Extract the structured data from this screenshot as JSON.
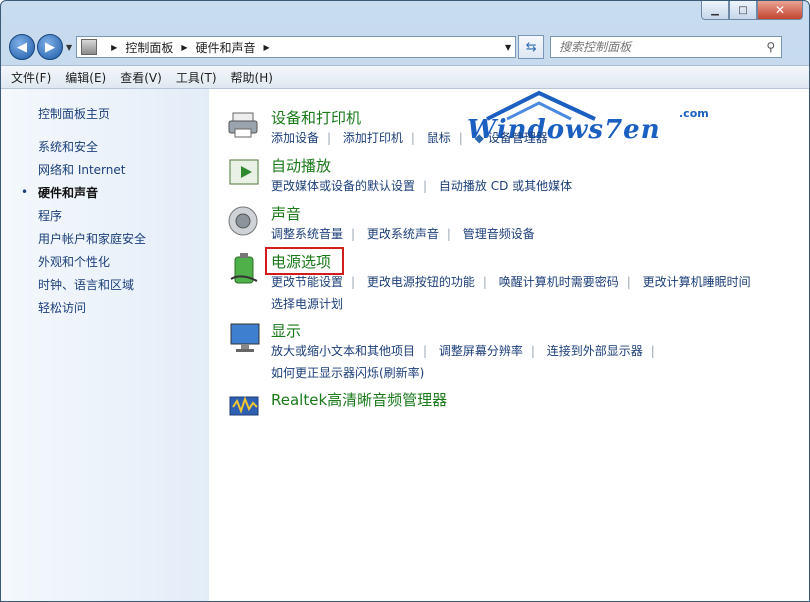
{
  "window": {
    "caption": {
      "minimize": "▁",
      "maximize": "□",
      "close": "✕"
    }
  },
  "address": {
    "crumbs": [
      "控制面板",
      "硬件和声音"
    ]
  },
  "search": {
    "placeholder": "搜索控制面板"
  },
  "menu": [
    "文件(F)",
    "编辑(E)",
    "查看(V)",
    "工具(T)",
    "帮助(H)"
  ],
  "sidebar": {
    "items": [
      "控制面板主页",
      "系统和安全",
      "网络和 Internet",
      "硬件和声音",
      "程序",
      "用户帐户和家庭安全",
      "外观和个性化",
      "时钟、语言和区域",
      "轻松访问"
    ],
    "active_index": 3
  },
  "watermark": {
    "text": "Windows7en",
    "com": ".com"
  },
  "categories": [
    {
      "title": "设备和打印机",
      "icon": "printer-icon",
      "links": [
        "添加设备",
        "添加打印机",
        "鼠标",
        "设备管理器"
      ],
      "links2": []
    },
    {
      "title": "自动播放",
      "icon": "autoplay-icon",
      "links": [
        "更改媒体或设备的默认设置",
        "自动播放 CD 或其他媒体"
      ],
      "links2": []
    },
    {
      "title": "声音",
      "icon": "speaker-icon",
      "links": [
        "调整系统音量",
        "更改系统声音",
        "管理音频设备"
      ],
      "links2": []
    },
    {
      "title": "电源选项",
      "icon": "power-battery-icon",
      "links": [
        "更改节能设置",
        "更改电源按钮的功能",
        "唤醒计算机时需要密码",
        "更改计算机睡眠时间"
      ],
      "links2": [
        "选择电源计划"
      ]
    },
    {
      "title": "显示",
      "icon": "display-icon",
      "links": [
        "放大或缩小文本和其他项目",
        "调整屏幕分辨率",
        "连接到外部显示器"
      ],
      "links2": [
        "如何更正显示器闪烁(刷新率)"
      ]
    },
    {
      "title": "Realtek高清晰音频管理器",
      "icon": "realtek-audio-icon",
      "links": [],
      "links2": []
    }
  ],
  "colors": {
    "accent_title": "#1a7a1a",
    "link": "#1c3f7a",
    "highlight_box": "#d21d1d"
  }
}
